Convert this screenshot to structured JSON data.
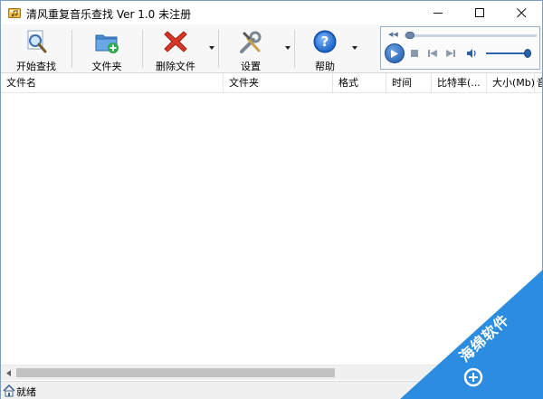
{
  "window": {
    "title": "清风重复音乐查找   Ver 1.0  未注册",
    "minimize_label": "minimize",
    "maximize_label": "maximize",
    "close_label": "close"
  },
  "toolbar": {
    "start_label": "开始查找",
    "folder_label": "文件夹",
    "delete_label": "删除文件",
    "settings_label": "设置",
    "help_label": "帮助"
  },
  "player": {
    "seek_position": 0.02,
    "volume_level": 0.92
  },
  "columns": [
    {
      "key": "filename",
      "label": "文件名"
    },
    {
      "key": "folder",
      "label": "文件夹"
    },
    {
      "key": "format",
      "label": "格式"
    },
    {
      "key": "duration",
      "label": "时间"
    },
    {
      "key": "bitrate",
      "label": "比特率(..."
    },
    {
      "key": "size",
      "label": "大小(Mb)"
    },
    {
      "key": "extra",
      "label": "音"
    }
  ],
  "rows": [],
  "status": {
    "text": "就绪"
  },
  "watermark": {
    "text": "海绵软件"
  },
  "colors": {
    "accent": "#2b7de0",
    "watermark": "#2c8ce0",
    "delete_red": "#d9362a",
    "help_blue": "#1e67c8",
    "folder_blue": "#4a8fd6",
    "folder_green": "#2fa84f"
  }
}
